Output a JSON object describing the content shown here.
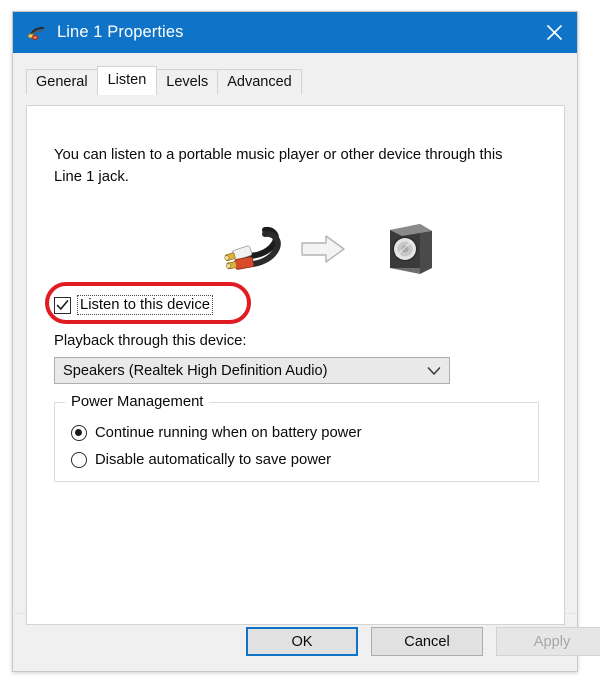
{
  "window": {
    "title": "Line 1 Properties",
    "icon": "audio-jack-icon",
    "close_label": "×",
    "titlebar_color": "#0f74c8"
  },
  "tabs": [
    {
      "label": "General",
      "selected": false
    },
    {
      "label": "Listen",
      "selected": true
    },
    {
      "label": "Levels",
      "selected": false
    },
    {
      "label": "Advanced",
      "selected": false
    }
  ],
  "listen_tab": {
    "description": "You can listen to a portable music player or other device through this Line 1 jack.",
    "graphics": {
      "source_icon": "rca-audio-cable-icon",
      "arrow_icon": "right-arrow-icon",
      "destination_icon": "speaker-icon"
    },
    "listen_checkbox": {
      "label": "Listen to this device",
      "checked": true,
      "focused": true
    },
    "playback": {
      "label": "Playback through this device:",
      "selected_option": "Speakers (Realtek High Definition Audio)",
      "options": [
        "Speakers (Realtek High Definition Audio)"
      ]
    },
    "power_management": {
      "title": "Power Management",
      "options": [
        {
          "label": "Continue running when on battery power",
          "selected": true
        },
        {
          "label": "Disable automatically to save power",
          "selected": false
        }
      ]
    }
  },
  "footer": {
    "ok_label": "OK",
    "cancel_label": "Cancel",
    "apply_label": "Apply",
    "apply_disabled": true
  },
  "annotation": {
    "type": "red-highlight-oval",
    "target": "listen-to-this-device-checkbox",
    "color": "#e01b22"
  }
}
